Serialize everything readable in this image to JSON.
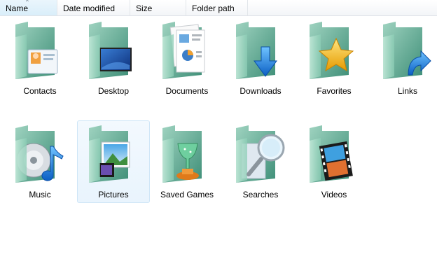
{
  "columns": {
    "name": "Name",
    "date_modified": "Date modified",
    "size": "Size",
    "folder_path": "Folder path"
  },
  "folders": [
    {
      "label": "Contacts",
      "icon": "contacts-icon"
    },
    {
      "label": "Desktop",
      "icon": "desktop-icon"
    },
    {
      "label": "Documents",
      "icon": "documents-icon"
    },
    {
      "label": "Downloads",
      "icon": "downloads-icon"
    },
    {
      "label": "Favorites",
      "icon": "favorites-icon"
    },
    {
      "label": "Links",
      "icon": "links-icon"
    },
    {
      "label": "Music",
      "icon": "music-icon"
    },
    {
      "label": "Pictures",
      "icon": "pictures-icon",
      "selected": true
    },
    {
      "label": "Saved Games",
      "icon": "saved-games-icon"
    },
    {
      "label": "Searches",
      "icon": "searches-icon"
    },
    {
      "label": "Videos",
      "icon": "videos-icon"
    }
  ],
  "colors": {
    "folder_back": "#5fb79a",
    "folder_front": "#9fd8c2",
    "selection": "#e9f4fd"
  }
}
